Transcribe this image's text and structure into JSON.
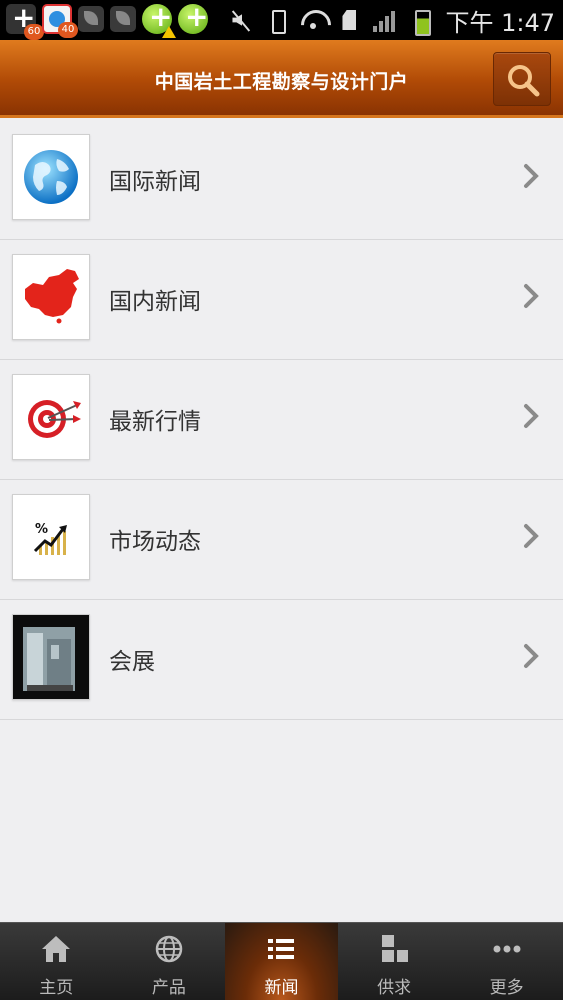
{
  "status_bar": {
    "notification_badges": [
      "60",
      "40"
    ],
    "time": "下午 1:47"
  },
  "header": {
    "title": "中国岩土工程勘察与设计门户",
    "search_icon": "search-icon"
  },
  "list": {
    "items": [
      {
        "label": "国际新闻",
        "icon": "globe-icon"
      },
      {
        "label": "国内新闻",
        "icon": "china-map-icon"
      },
      {
        "label": "最新行情",
        "icon": "target-icon"
      },
      {
        "label": "市场动态",
        "icon": "trend-chart-icon"
      },
      {
        "label": "会展",
        "icon": "exhibition-photo"
      }
    ]
  },
  "tabbar": {
    "tabs": [
      {
        "label": "主页",
        "icon": "home-icon",
        "active": false
      },
      {
        "label": "产品",
        "icon": "globe-icon",
        "active": false
      },
      {
        "label": "新闻",
        "icon": "list-icon",
        "active": true
      },
      {
        "label": "供求",
        "icon": "blocks-icon",
        "active": false
      },
      {
        "label": "更多",
        "icon": "more-icon",
        "active": false
      }
    ]
  },
  "colors": {
    "header_orange": "#b04a06",
    "accent": "#e07b1e",
    "list_background": "#efeff1",
    "tabbar_background": "#1c1c1c"
  }
}
